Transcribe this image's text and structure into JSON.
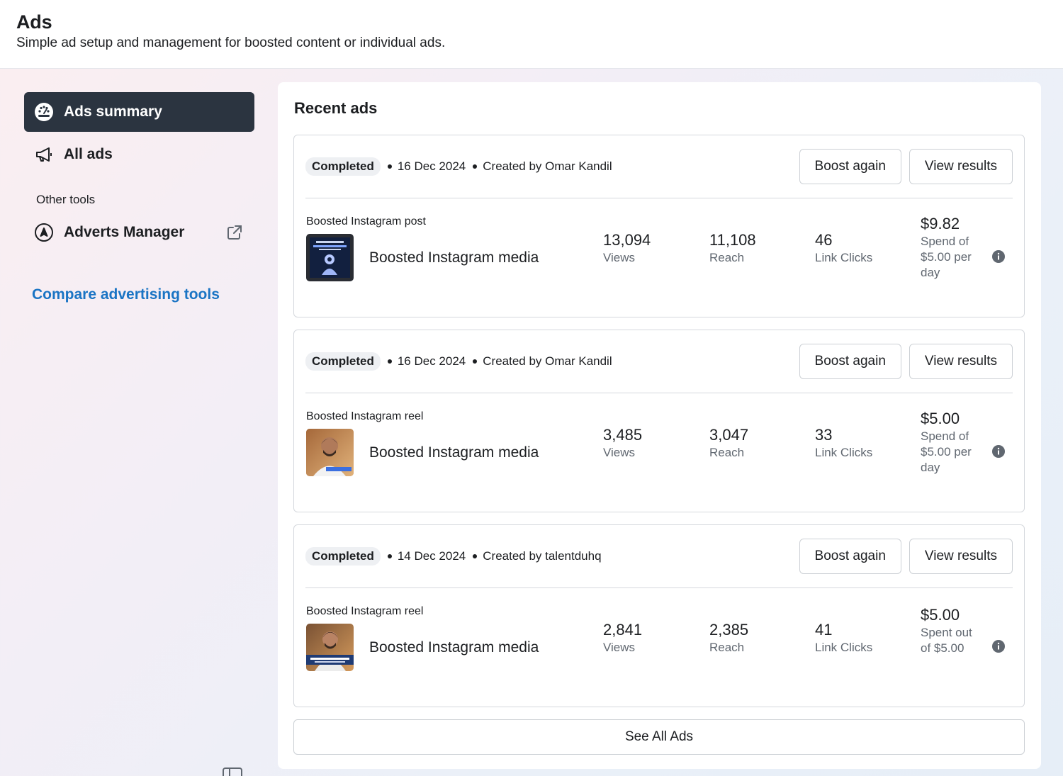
{
  "header": {
    "title": "Ads",
    "subtitle": "Simple ad setup and management for boosted content or individual ads."
  },
  "sidebar": {
    "items": [
      {
        "label": "Ads summary",
        "icon": "dashboard-gauge-icon",
        "active": true
      },
      {
        "label": "All ads",
        "icon": "megaphone-icon",
        "active": false
      }
    ],
    "other_tools_label": "Other tools",
    "adverts_manager": {
      "label": "Adverts Manager",
      "icon": "adverts-manager-icon",
      "trailing_icon": "external-link-icon"
    },
    "compare_link": "Compare advertising tools"
  },
  "main": {
    "title": "Recent ads",
    "ads": [
      {
        "status": "Completed",
        "date": "16 Dec 2024",
        "created_by": "Created by Omar Kandil",
        "boost_label": "Boost again",
        "view_label": "View results",
        "type": "Boosted Instagram post",
        "name": "Boosted Instagram media",
        "views": "13,094",
        "views_label": "Views",
        "reach": "11,108",
        "reach_label": "Reach",
        "clicks": "46",
        "clicks_label": "Link Clicks",
        "spend": "$9.82",
        "spend_label": "Spend of $5.00 per day",
        "thumb_style": "dark"
      },
      {
        "status": "Completed",
        "date": "16 Dec 2024",
        "created_by": "Created by Omar Kandil",
        "boost_label": "Boost again",
        "view_label": "View results",
        "type": "Boosted Instagram reel",
        "name": "Boosted Instagram media",
        "views": "3,485",
        "views_label": "Views",
        "reach": "3,047",
        "reach_label": "Reach",
        "clicks": "33",
        "clicks_label": "Link Clicks",
        "spend": "$5.00",
        "spend_label": "Spend of $5.00 per day",
        "thumb_style": "person-blue"
      },
      {
        "status": "Completed",
        "date": "14 Dec 2024",
        "created_by": "Created by talentduhq",
        "boost_label": "Boost again",
        "view_label": "View results",
        "type": "Boosted Instagram reel",
        "name": "Boosted Instagram media",
        "views": "2,841",
        "views_label": "Views",
        "reach": "2,385",
        "reach_label": "Reach",
        "clicks": "41",
        "clicks_label": "Link Clicks",
        "spend": "$5.00",
        "spend_label": "Spent out of $5.00",
        "thumb_style": "person-warm"
      }
    ],
    "see_all_label": "See All Ads"
  },
  "colors": {
    "active_nav_bg": "#2b3440",
    "link": "#1a74c4",
    "muted_text": "#606770",
    "border": "#d5d8dd"
  }
}
